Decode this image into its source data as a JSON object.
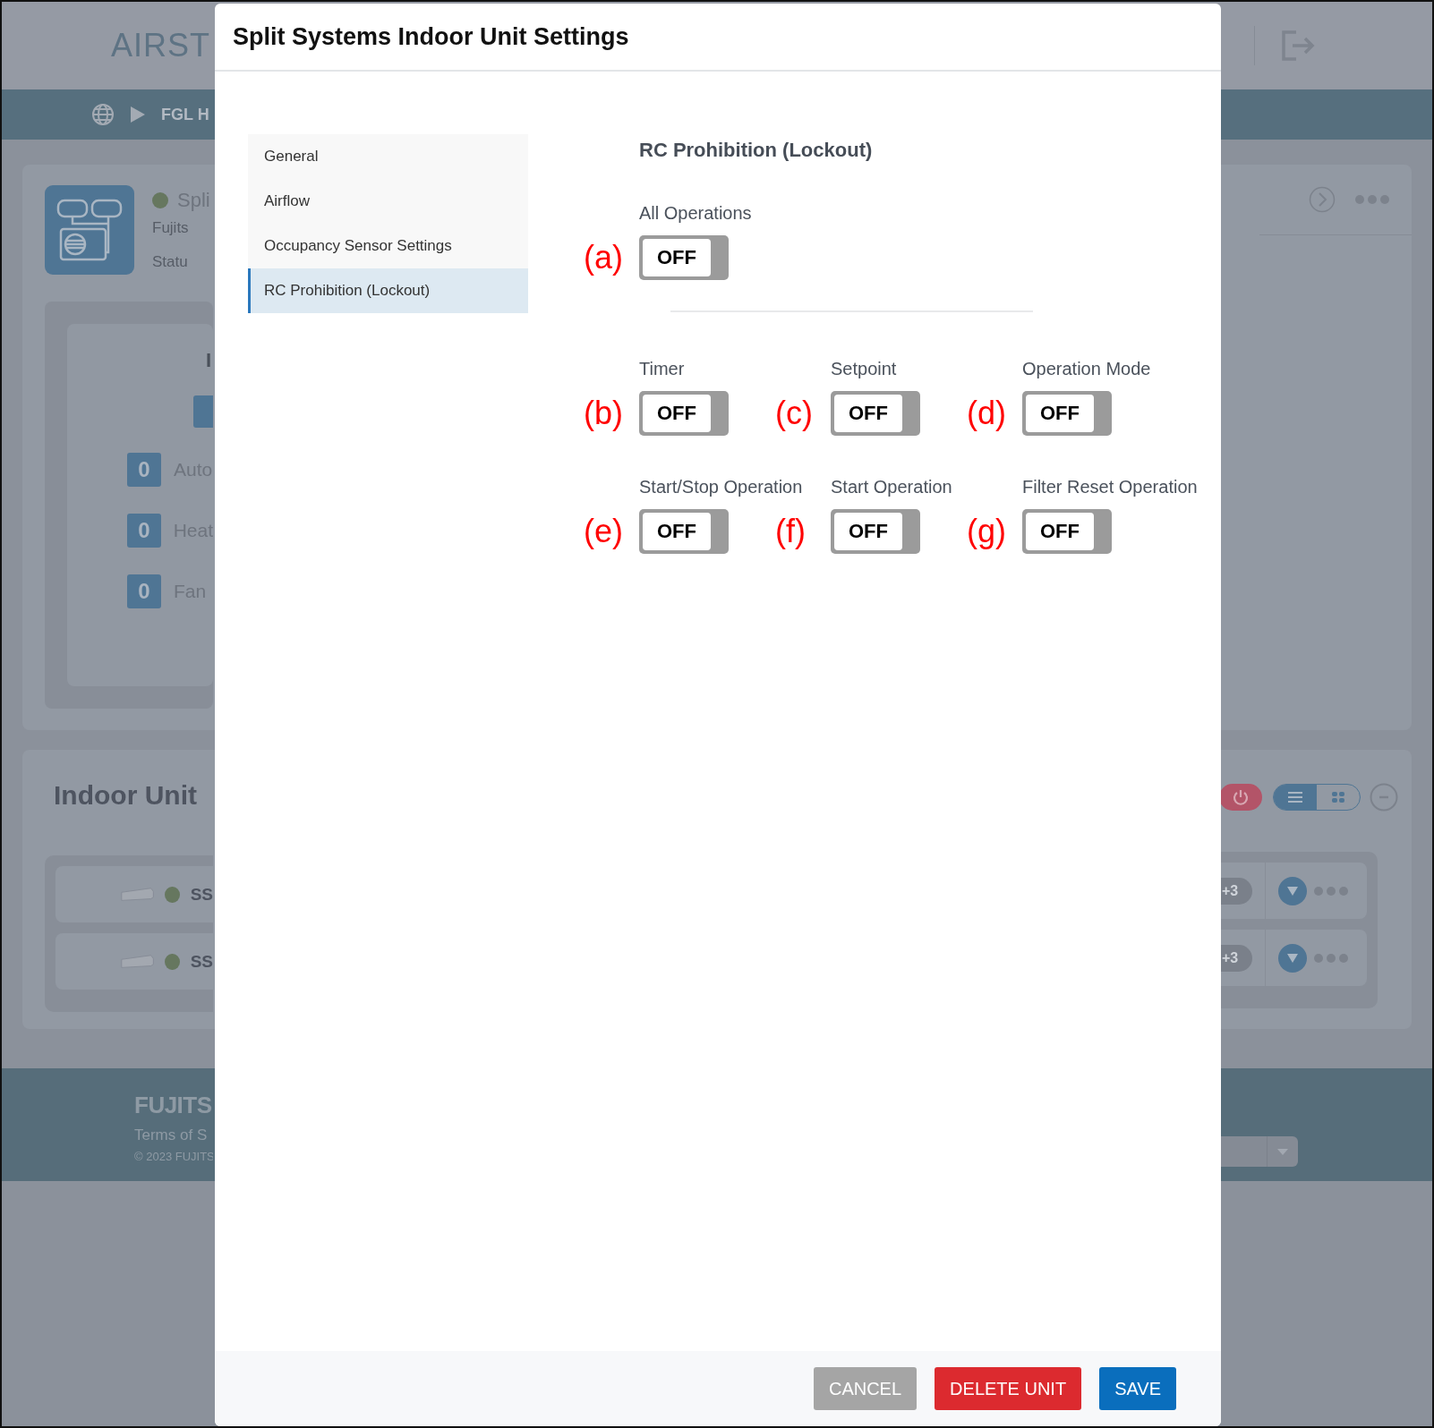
{
  "app": {
    "logo": "AIRST",
    "breadcrumb": "FGL H",
    "system": {
      "name": "Spli",
      "brand": "Fujits",
      "status": "Statu"
    },
    "summary": {
      "heading": "I",
      "modes": [
        {
          "count": "0",
          "label": "Auto"
        },
        {
          "count": "0",
          "label": "Heat"
        },
        {
          "count": "0",
          "label": "Fan"
        }
      ]
    },
    "indoor_units": {
      "title": "Indoor Unit",
      "rows": [
        {
          "name": "SS",
          "extra": "+3"
        },
        {
          "name": "SS",
          "extra": "+3"
        }
      ]
    },
    "footer": {
      "brand": "FUJITS",
      "terms": "Terms of S",
      "copyright": "© 2023 FUJITS"
    }
  },
  "dialog": {
    "title": "Split Systems Indoor Unit Settings",
    "nav": [
      {
        "label": "General",
        "selected": false
      },
      {
        "label": "Airflow",
        "selected": false
      },
      {
        "label": "Occupancy Sensor Settings",
        "selected": false
      },
      {
        "label": "RC Prohibition (Lockout)",
        "selected": true
      }
    ],
    "section_title": "RC Prohibition (Lockout)",
    "groups": [
      {
        "settings": [
          {
            "label": "All Operations",
            "annotation": "(a)",
            "state_text": "OFF",
            "on": false
          }
        ]
      },
      {
        "settings": [
          {
            "label": "Timer",
            "annotation": "(b)",
            "state_text": "OFF",
            "on": false
          },
          {
            "label": "Setpoint",
            "annotation": "(c)",
            "state_text": "OFF",
            "on": false
          },
          {
            "label": "Operation Mode",
            "annotation": "(d)",
            "state_text": "OFF",
            "on": false
          },
          {
            "label": "Start/Stop Operation",
            "annotation": "(e)",
            "state_text": "OFF",
            "on": false
          },
          {
            "label": "Start Operation",
            "annotation": "(f)",
            "state_text": "OFF",
            "on": false
          },
          {
            "label": "Filter Reset Operation",
            "annotation": "(g)",
            "state_text": "OFF",
            "on": false
          }
        ]
      }
    ],
    "buttons": [
      {
        "label": "CANCEL",
        "kind": "neutral"
      },
      {
        "label": "DELETE UNIT",
        "kind": "danger"
      },
      {
        "label": "SAVE",
        "kind": "primary"
      }
    ]
  }
}
